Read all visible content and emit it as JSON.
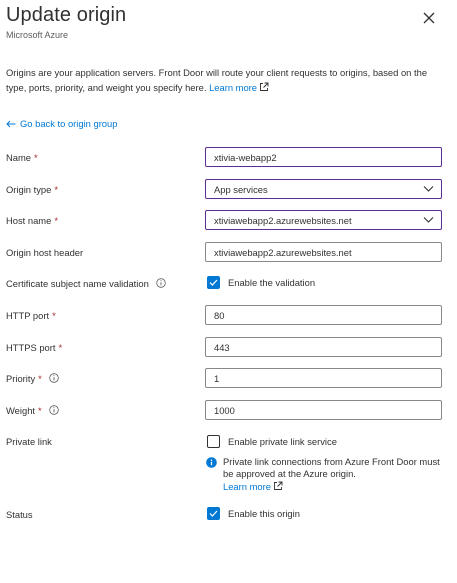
{
  "header": {
    "title": "Update origin",
    "subtitle": "Microsoft Azure"
  },
  "intro": {
    "text": "Origins are your application servers. Front Door will route your client requests to origins, based on the type, ports, priority, and weight you specify here.",
    "learn_more": "Learn more"
  },
  "back_link": "Go back to origin group",
  "form": {
    "name": {
      "label": "Name",
      "required": "*",
      "value": "xtivia-webapp2"
    },
    "origin_type": {
      "label": "Origin type",
      "required": "*",
      "value": "App services"
    },
    "host_name": {
      "label": "Host name",
      "required": "*",
      "value": "xtiviawebapp2.azurewebsites.net"
    },
    "origin_host_header": {
      "label": "Origin host header",
      "value": "xtiviawebapp2.azurewebsites.net"
    },
    "cert_validation": {
      "label": "Certificate subject name validation",
      "checkbox_label": "Enable the validation",
      "checked": true
    },
    "http_port": {
      "label": "HTTP port",
      "required": "*",
      "value": "80"
    },
    "https_port": {
      "label": "HTTPS port",
      "required": "*",
      "value": "443"
    },
    "priority": {
      "label": "Priority",
      "required": "*",
      "value": "1"
    },
    "weight": {
      "label": "Weight",
      "required": "*",
      "value": "1000"
    },
    "private_link": {
      "label": "Private link",
      "checkbox_label": "Enable private link service",
      "checked": false,
      "note": "Private link connections from Azure Front Door must be approved at the Azure origin.",
      "learn_more": "Learn more"
    },
    "status": {
      "label": "Status",
      "checkbox_label": "Enable this origin",
      "checked": true
    }
  },
  "colors": {
    "accent": "#0078d4",
    "required": "#a4262c",
    "focus_border": "#5c2e91",
    "text": "#323130"
  }
}
